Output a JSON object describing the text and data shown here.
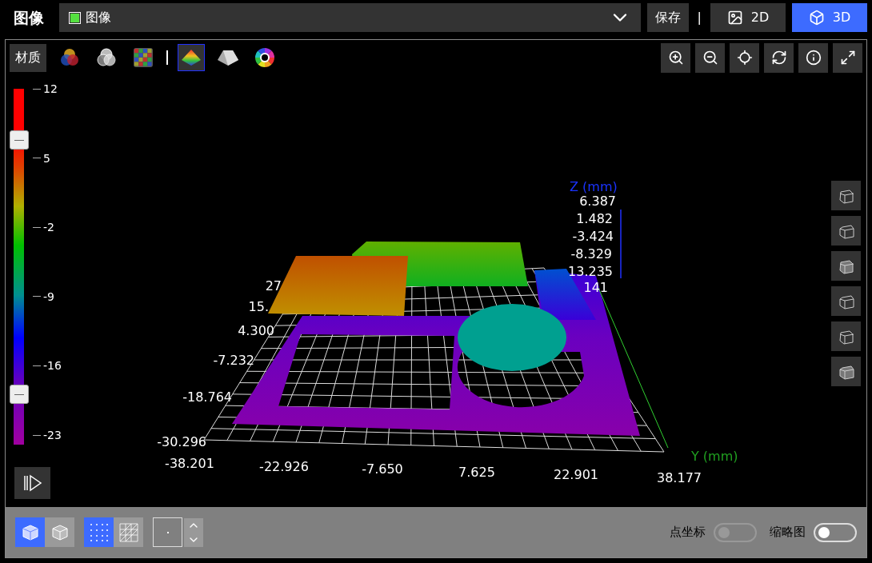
{
  "header": {
    "title": "图像",
    "source": {
      "label": "图像",
      "checked": true
    },
    "save": "保存",
    "separator": "|",
    "views": [
      {
        "label": "2D",
        "kind": "image",
        "selected": false
      },
      {
        "label": "3D",
        "kind": "cube",
        "selected": true
      }
    ]
  },
  "toolbar": {
    "material": "材质",
    "color_groups": [
      [
        {
          "kind": "rgb",
          "selected": false
        },
        {
          "kind": "gray",
          "selected": false
        },
        {
          "kind": "mosaic",
          "selected": false
        }
      ],
      [
        {
          "kind": "height",
          "selected": true
        },
        {
          "kind": "shade",
          "selected": false
        },
        {
          "kind": "hue",
          "selected": false
        }
      ]
    ]
  },
  "colorbar": {
    "ticks": [
      "12",
      "5",
      "-2",
      "-9",
      "-16",
      "-23"
    ]
  },
  "plot": {
    "z_axis_title": "Z (mm)",
    "y_axis_title": "Y (mm)",
    "z_ticks": [
      "6.387",
      "1.482",
      "-3.424",
      "-8.329",
      "13.235",
      "141"
    ],
    "x_ticks": [
      "27",
      "15.",
      "4.300",
      "-7.232",
      "-18.764",
      "-30.296"
    ],
    "y_ticks": [
      "-38.201",
      "-22.926",
      "-7.650",
      "7.625",
      "22.901",
      "38.177"
    ]
  },
  "bottom": {
    "render_modes": [
      {
        "kind": "solid",
        "selected": true
      },
      {
        "kind": "wire",
        "selected": false
      }
    ],
    "point_modes": [
      {
        "kind": "points",
        "selected": true
      },
      {
        "kind": "mesh",
        "selected": false
      }
    ],
    "toggles": [
      {
        "label": "点坐标",
        "on": false,
        "disabled": true
      },
      {
        "label": "缩略图",
        "on": false,
        "disabled": false
      }
    ]
  }
}
